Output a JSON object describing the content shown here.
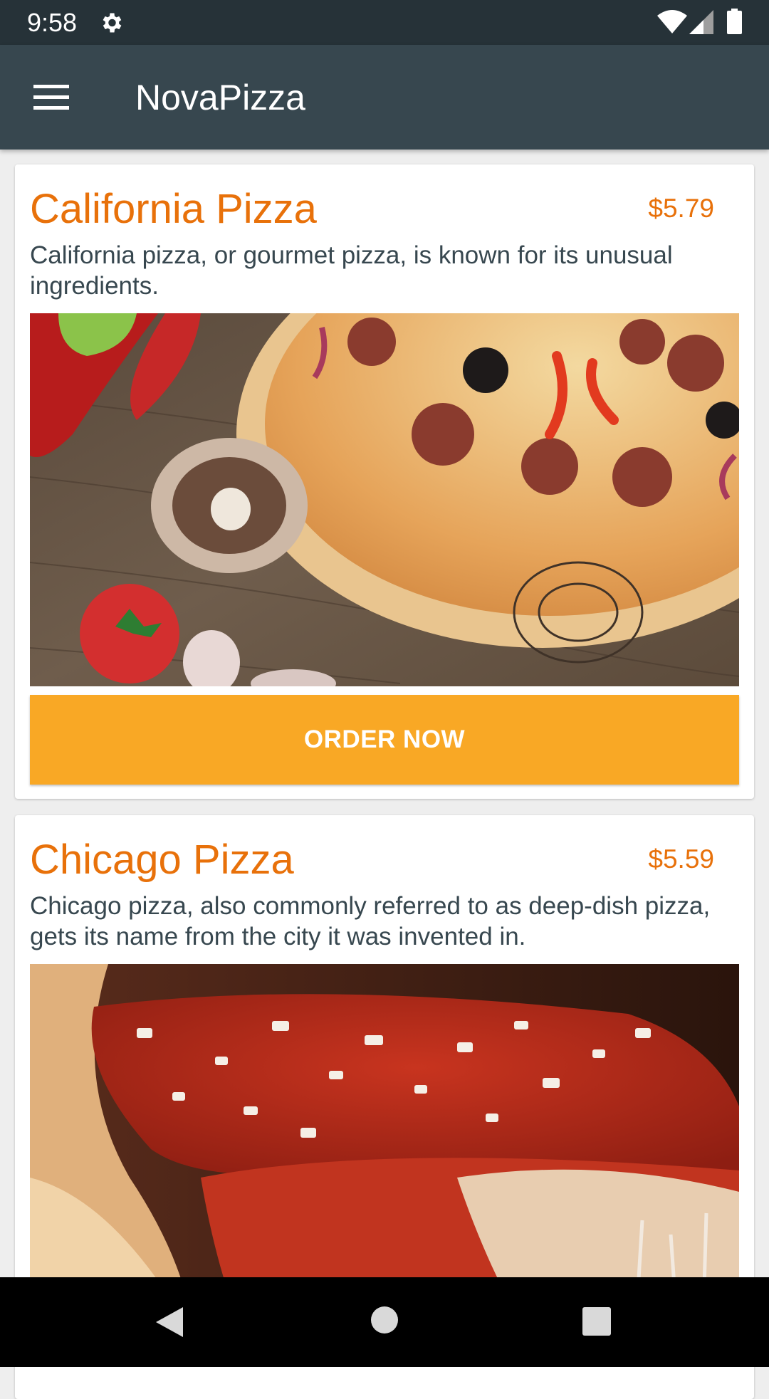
{
  "status_bar": {
    "time": "9:58",
    "icons": [
      "gear-icon",
      "wifi-icon",
      "cell-signal-icon",
      "battery-icon"
    ]
  },
  "app_bar": {
    "title": "NovaPizza",
    "menu_icon": "hamburger-menu-icon"
  },
  "pizzas": [
    {
      "name": "California Pizza",
      "price": "$5.79",
      "description": "California pizza, or gourmet pizza, is known for its unusual ingredients.",
      "order_label": "ORDER NOW"
    },
    {
      "name": "Chicago Pizza",
      "price": "$5.59",
      "description": "Chicago pizza, also commonly referred to as deep-dish pizza, gets its name from the city it was invented in."
    }
  ],
  "nav_bar": {
    "icons": [
      "back-icon",
      "home-icon",
      "recents-icon"
    ]
  },
  "colors": {
    "status_bar": "#263238",
    "app_bar": "#37474f",
    "accent_text": "#e8710a",
    "order_button": "#f9a825",
    "background": "#eeeeee"
  }
}
